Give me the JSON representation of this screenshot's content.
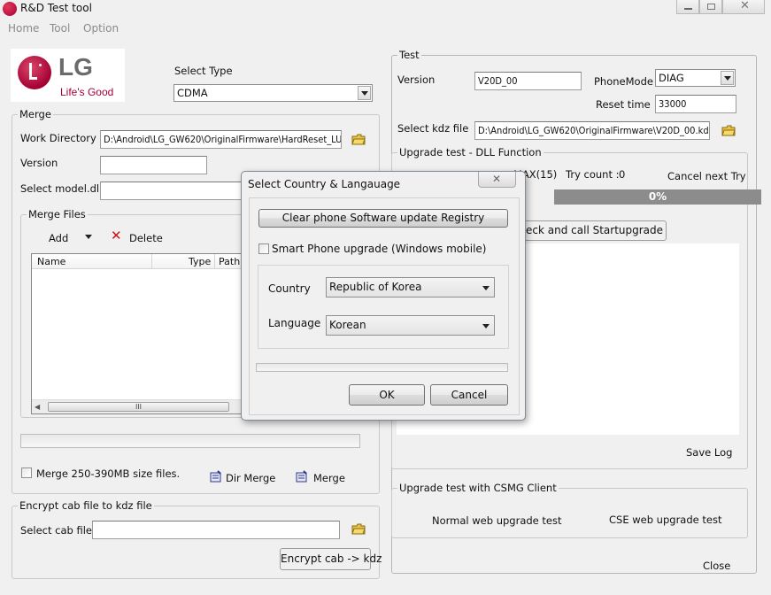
{
  "app": {
    "title": "R&D Test tool"
  },
  "menu": [
    "Home",
    "Tool",
    "Option"
  ],
  "logo": {
    "brand": "LG",
    "tagline": "Life's Good"
  },
  "select_type": {
    "label": "Select Type",
    "value": "CDMA"
  },
  "merge": {
    "title": "Merge",
    "work_directory_label": "Work Directory",
    "work_directory_value": "D:\\Android\\LG_GW620\\OriginalFirmware\\HardReset_LU",
    "version_label": "Version",
    "version_value": "",
    "select_model_label": "Select model.dll",
    "merge_files_title": "Merge Files",
    "add_label": "Add",
    "delete_label": "Delete",
    "columns": [
      "Name",
      "Type",
      "Path"
    ],
    "scroll_thumb": "III",
    "size_checkbox_label": "Merge 250-390MB size files.",
    "dir_merge_label": "Dir Merge",
    "merge_button_label": "Merge"
  },
  "encrypt": {
    "title": "Encrypt cab file to kdz file",
    "select_cab_label": "Select cab file",
    "button_label": "Encrypt cab -> kdz"
  },
  "test": {
    "title": "Test",
    "version_label": "Version",
    "version_value": "V20D_00",
    "phone_mode_label": "PhoneMode",
    "phone_mode_value": "DIAG",
    "reset_time_label": "Reset time",
    "reset_time_value": "33000",
    "select_kdz_label": "Select kdz file",
    "select_kdz_value": "D:\\Android\\LG_GW620\\OriginalFirmware\\V20D_00.kdz",
    "dll_title": "Upgrade test - DLL Function",
    "max_label": "MAX(15)",
    "try_count_label": "Try count :",
    "try_count_value": "0",
    "cancel_next_label": "Cancel next Try",
    "progress_text": "0%",
    "progress_value": 0,
    "start_button_partial": "pe check and call Startupgrade",
    "save_log_label": "Save Log",
    "csmg_title": "Upgrade test with CSMG Client",
    "normal_web_label": "Normal web upgrade test",
    "cse_web_label": "CSE web upgrade test",
    "close_label": "Close"
  },
  "dialog": {
    "title": "Select Country & Langauage",
    "clear_registry_label": "Clear phone Software update Registry",
    "smartphone_label": "Smart Phone upgrade (Windows mobile)",
    "country_label": "Country",
    "country_value": "Republic of Korea",
    "language_label": "Language",
    "language_value": "Korean",
    "ok_label": "OK",
    "cancel_label": "Cancel"
  },
  "colors": {
    "lg_red": "#a50034",
    "progress_fill": "#8c8c8c",
    "dialog_border": "#7f8a95"
  }
}
